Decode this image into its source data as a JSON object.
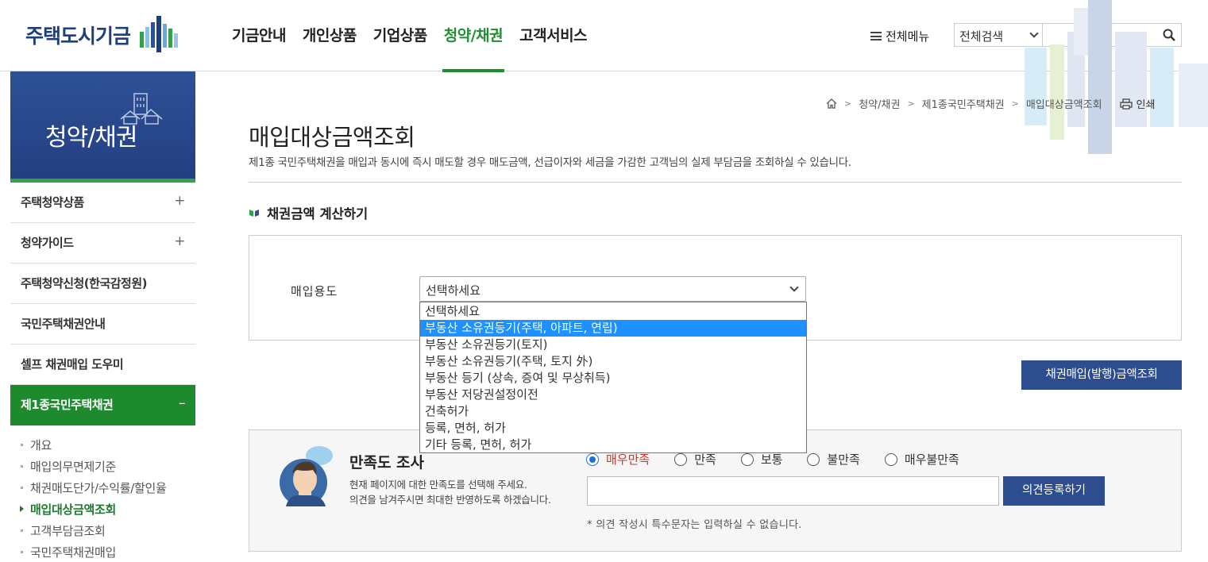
{
  "header": {
    "logo_text": "주택도시기금",
    "nav": [
      "기금안내",
      "개인상품",
      "기업상품",
      "청약/채권",
      "고객서비스"
    ],
    "active_nav": "청약/채권",
    "all_menu_label": "전체메뉴",
    "search_scope": "전체검색",
    "search_value": ""
  },
  "sidebar": {
    "title": "청약/채권",
    "items": [
      {
        "label": "주택청약상품",
        "toggle": "+"
      },
      {
        "label": "청약가이드",
        "toggle": "+"
      },
      {
        "label": "주택청약신청(한국감정원)",
        "toggle": ""
      },
      {
        "label": "국민주택채권안내",
        "toggle": ""
      },
      {
        "label": "셀프 채권매입 도우미",
        "toggle": ""
      },
      {
        "label": "제1종국민주택채권",
        "toggle": "–"
      }
    ],
    "sub_items": [
      "개요",
      "매입의무면제기준",
      "채권매도단가/수익률/할인율",
      "매입대상금액조회",
      "고객부담금조회",
      "국민주택채권매입"
    ],
    "active_sub": "매입대상금액조회"
  },
  "breadcrumb": {
    "items": [
      "청약/채권",
      "제1종국민주택채권",
      "매입대상금액조회"
    ],
    "print_label": "인쇄"
  },
  "page": {
    "title": "매입대상금액조회",
    "description": "제1종 국민주택채권을 매입과 동시에 즉시 매도할 경우 매도금액, 선급이자와 세금을 가감한 고객님의 실제 부담금을 조회하실 수 있습니다.",
    "section_title": "채권금액 계산하기"
  },
  "form": {
    "purpose_label": "매입용도",
    "purpose_value": "선택하세요",
    "options": [
      "선택하세요",
      "부동산 소유권등기(주택, 아파트, 연립)",
      "부동산 소유권등기(토지)",
      "부동산 소유권등기(주택, 토지 外)",
      "부동산 등기 (상속, 증여 및 무상취득)",
      "부동산 저당권설정이전",
      "건축허가",
      "등록, 면허, 허가",
      "기타 등록, 면허, 허가"
    ],
    "highlighted_option_index": 1,
    "inquiry_button": "채권매입(발행)금액조회"
  },
  "survey": {
    "title": "만족도 조사",
    "desc_line1": "현재 페이지에 대한 만족도를 선택해 주세요.",
    "desc_line2": "의견을 남겨주시면 최대한 반영하도록 하겠습니다.",
    "options": [
      "매우만족",
      "만족",
      "보통",
      "불만족",
      "매우불만족"
    ],
    "selected": "매우만족",
    "opinion_value": "",
    "submit_label": "의견등록하기",
    "note": "* 의견 작성시 특수문자는 입력하실 수 없습니다."
  },
  "colors": {
    "brand_navy": "#2e4d8f",
    "brand_green": "#1d8a2e",
    "dropdown_highlight": "#1e90ff"
  }
}
